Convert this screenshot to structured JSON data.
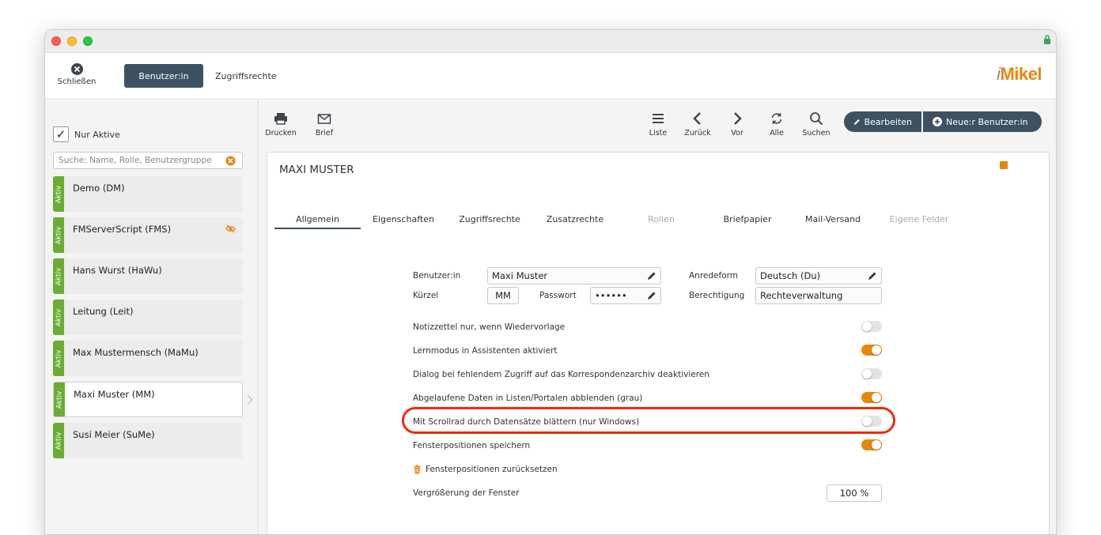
{
  "window": {
    "close_label": "Schließen",
    "logo_text": "iMikel"
  },
  "topbar": {
    "user_button": "Benutzer:in",
    "rights_link": "Zugriffsrechte"
  },
  "sidebar": {
    "only_active_label": "Nur Aktive",
    "only_active_checked": true,
    "search_placeholder": "Suche: Name, Rolle, Benutzergruppe",
    "status_tag": "Aktiv",
    "users": [
      {
        "name": "Demo (DM)",
        "status": "Aktiv"
      },
      {
        "name": "FMServerScript (FMS)",
        "status": "Aktiv",
        "hidden_icon": "eye-slash-icon"
      },
      {
        "name": "Hans Wurst (HaWu)",
        "status": "Aktiv"
      },
      {
        "name": "Leitung (Leit)",
        "status": "Aktiv"
      },
      {
        "name": "Max Mustermensch (MaMu)",
        "status": "Aktiv"
      },
      {
        "name": "Maxi Muster (MM)",
        "status": "Aktiv",
        "selected": true
      },
      {
        "name": "Susi Meier (SuMe)",
        "status": "Aktiv"
      }
    ]
  },
  "toolbar": {
    "print": "Drucken",
    "letter": "Brief",
    "list": "Liste",
    "back": "Zurück",
    "forward": "Vor",
    "all": "Alle",
    "search": "Suchen",
    "edit": "Bearbeiten",
    "new_user": "Neue:r Benutzer:in"
  },
  "record": {
    "title": "MAXI MUSTER",
    "tabs": [
      {
        "label": "Allgemein",
        "active": true
      },
      {
        "label": "Eigenschaften"
      },
      {
        "label": "Zugriffsrechte"
      },
      {
        "label": "Zusatzrechte"
      },
      {
        "label": "Rollen",
        "disabled": true
      },
      {
        "label": "Briefpapier"
      },
      {
        "label": "Mail-Versand"
      },
      {
        "label": "Eigene Felder",
        "disabled": true
      }
    ],
    "fields": {
      "user_label": "Benutzer:in",
      "user_value": "Maxi Muster",
      "salutation_label": "Anredeform",
      "salutation_value": "Deutsch (Du)",
      "short_label": "Kürzel",
      "short_value": "MM",
      "password_label": "Passwort",
      "password_value": "••••••",
      "permission_label": "Berechtigung",
      "permission_value": "Rechteverwaltung"
    },
    "settings": [
      {
        "label": "Notizzettel nur, wenn Wiedervorlage",
        "on": false
      },
      {
        "label": "Lernmodus in Assistenten aktiviert",
        "on": true
      },
      {
        "label": "Dialog bei fehlendem Zugriff auf das Korrespondenzarchiv deaktivieren",
        "on": false
      },
      {
        "label": "Abgelaufene Daten in Listen/Portalen abblenden (grau)",
        "on": true
      },
      {
        "label": "Mit Scrollrad durch Datensätze blättern (nur Windows)",
        "on": false,
        "highlighted": true
      },
      {
        "label": "Fensterpositionen speichern",
        "on": true
      }
    ],
    "reset_positions": "Fensterpositionen zurücksetzen",
    "zoom_label": "Vergrößerung der Fenster",
    "zoom_value": "100 %"
  }
}
